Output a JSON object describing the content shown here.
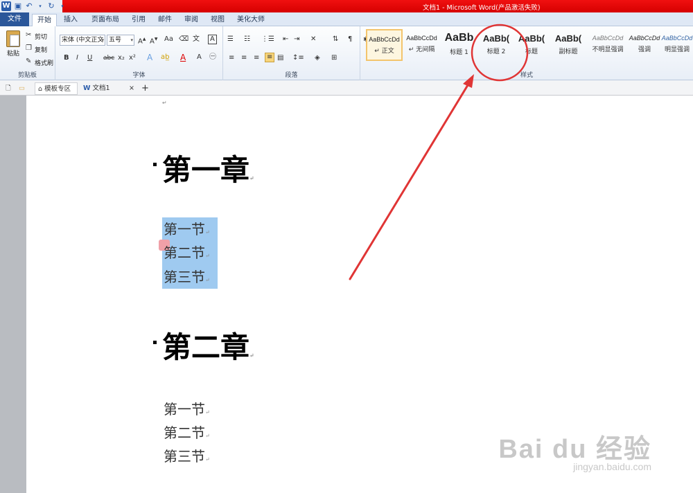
{
  "window": {
    "title": "文档1 - Microsoft Word(产品激活失败)"
  },
  "menu": {
    "file": "文件",
    "tabs": [
      "开始",
      "插入",
      "页面布局",
      "引用",
      "邮件",
      "审阅",
      "视图",
      "美化大师"
    ]
  },
  "ribbon": {
    "clipboard": {
      "paste": "粘贴",
      "cut": "剪切",
      "copy": "复制",
      "format_painter": "格式刷",
      "label": "剪贴板"
    },
    "font": {
      "font_name": "宋体 (中文正文",
      "font_size": "五号",
      "label": "字体"
    },
    "paragraph": {
      "label": "段落"
    },
    "styles": {
      "label": "样式",
      "items": [
        {
          "sample": "AaBbCcDd",
          "name": "↵ 正文"
        },
        {
          "sample": "AaBbCcDd",
          "name": "↵ 无间隔"
        },
        {
          "sample": "AaBb",
          "name": "标题 1"
        },
        {
          "sample": "AaBb(",
          "name": "标题 2"
        },
        {
          "sample": "AaBb(",
          "name": "标题"
        },
        {
          "sample": "AaBb(",
          "name": "副标题"
        },
        {
          "sample": "AaBbCcDd",
          "name": "不明显强调"
        },
        {
          "sample": "AaBbCcDd",
          "name": "强调"
        },
        {
          "sample": "AaBbCcDd",
          "name": "明显强调"
        }
      ]
    }
  },
  "doc_tabs": {
    "template_zone": "模板专区",
    "doc_name": "文档1",
    "close": "×",
    "new": "+"
  },
  "document": {
    "chapter1": "第一章",
    "chapter1_sections": [
      "第一节",
      "第二节",
      "第三节"
    ],
    "chapter2": "第二章",
    "chapter2_sections": [
      "第一节",
      "第二节",
      "第三节"
    ],
    "para_mark": "↵"
  },
  "watermark": {
    "brand": "Bai du 经验",
    "url": "jingyan.baidu.com"
  },
  "colors": {
    "title_bar": "#e00000",
    "file_tab": "#2b579a",
    "selection": "#9fcaf0",
    "annotation": "#e03535",
    "selected_style_border": "#f3c46c"
  }
}
